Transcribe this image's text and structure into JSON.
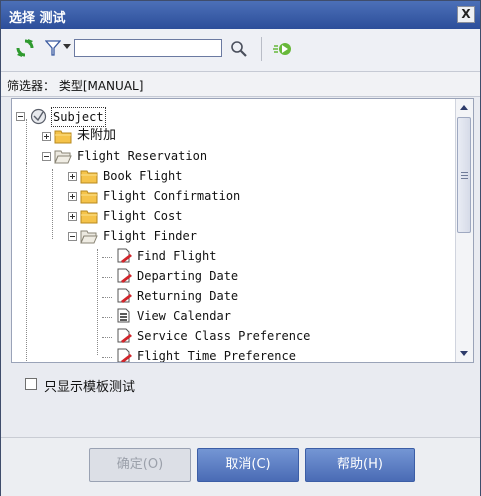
{
  "window": {
    "title": "选择 测试",
    "close_label": "X"
  },
  "toolbar": {
    "refresh_icon": "refresh-icon",
    "filter_icon": "filter-icon",
    "search_value": "",
    "search_placeholder": "",
    "search_icon": "magnifier-icon",
    "go_icon": "go-to-icon"
  },
  "filter": {
    "text": "筛选器：  类型[MANUAL]"
  },
  "tree": {
    "root": "Subject",
    "unattached": "未附加",
    "flight_reservation": "Flight Reservation",
    "book_flight": "Book Flight",
    "flight_confirmation": "Flight Confirmation",
    "flight_cost": "Flight Cost",
    "flight_finder": "Flight Finder",
    "tests": [
      "Find Flight",
      "Departing Date",
      "Returning Date",
      "View Calendar",
      "Service Class Preference",
      "Flight Time Preference"
    ]
  },
  "options": {
    "template_only_label": "只显示模板测试",
    "template_only_checked": false
  },
  "buttons": {
    "ok": "确定(O)",
    "cancel": "取消(C)",
    "help": "帮助(H)"
  },
  "colors": {
    "title_bar": "#2c4e9a",
    "button_blue": "#4a6bb5",
    "folder": "#f5c34a",
    "test_icon_red": "#d0262b"
  }
}
